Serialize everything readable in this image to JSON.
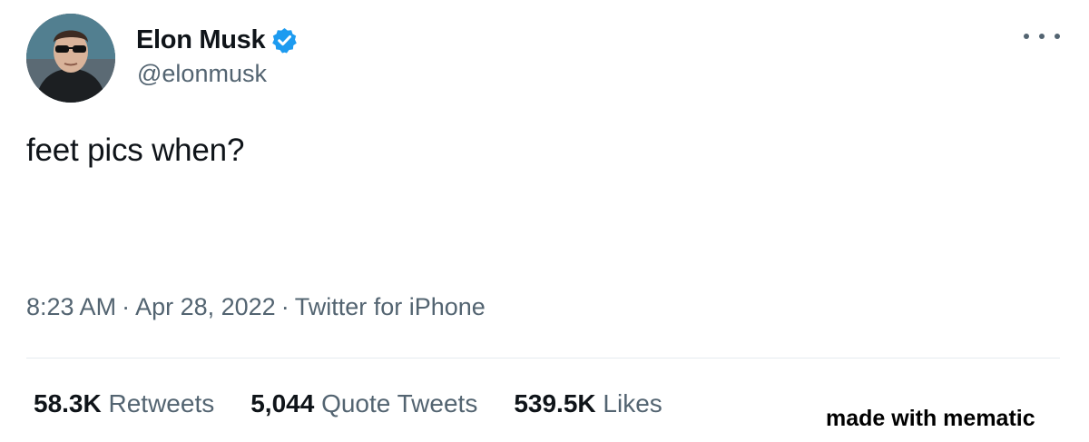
{
  "author": {
    "display_name": "Elon Musk",
    "handle": "@elonmusk",
    "verified": true,
    "avatar_icon": "profile-photo-avatar"
  },
  "menu": {
    "more_icon": "more-horizontal-icon"
  },
  "tweet": {
    "text": "feet pics when?",
    "time": "8:23 AM",
    "date": "Apr 28, 2022",
    "source": "Twitter for iPhone",
    "separator": "·"
  },
  "stats": {
    "retweets_count": "58.3K",
    "retweets_label": "Retweets",
    "quotes_count": "5,044",
    "quotes_label": "Quote Tweets",
    "likes_count": "539.5K",
    "likes_label": "Likes"
  },
  "watermark": {
    "text": "made with mematic"
  },
  "colors": {
    "primary_text": "#0f1419",
    "secondary_text": "#536471",
    "verified_badge": "#1d9bf0",
    "divider": "#e6ecf0"
  }
}
